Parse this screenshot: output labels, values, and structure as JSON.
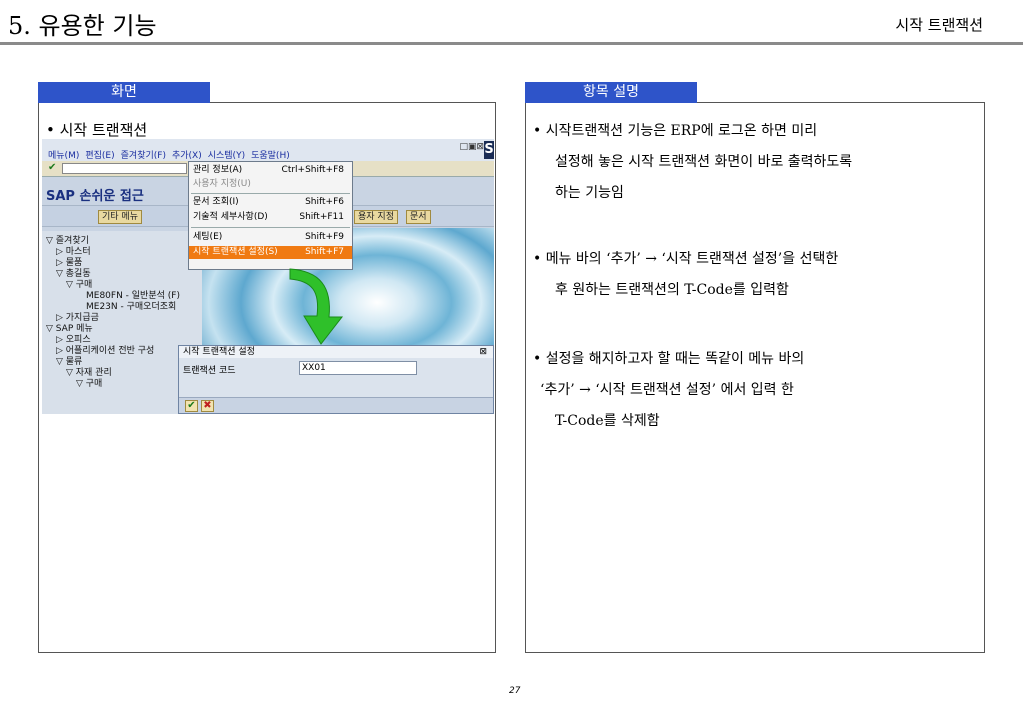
{
  "header": {
    "title": "5. 유용한 기능",
    "subtitle": "시작 트랜잭션"
  },
  "left_panel": {
    "tab": "화면",
    "bullet": "• 시작 트랜잭션"
  },
  "right_panel": {
    "tab": "항목 설명",
    "lines": [
      "• 시작트랜잭션 기능은 ERP에 로그온 하면 미리",
      "설정해 놓은 시작 트랜잭션 화면이 바로 출력하도록",
      "하는 기능임",
      "• 메뉴 바의 ‘추가’ → ‘시작 트랜잭션 설정’을 선택한",
      "후 원하는 트랜잭션의 T-Code를 입력함",
      "• 설정을 해지하고자 할 때는 똑같이 메뉴 바의",
      "‘추가’ → ‘시작 트랜잭션 설정’ 에서 입력 한",
      "T-Code를 삭제함"
    ]
  },
  "sap": {
    "menu": [
      "메뉴(M)",
      "편집(E)",
      "즐겨찾기(F)",
      "추가(X)",
      "시스템(Y)",
      "도움말(H)"
    ],
    "logo_letter": "S",
    "heading": "SAP 손쉬운 접근",
    "buttons": {
      "other_menu": "기타 메뉴",
      "user_setting": "용자 지정",
      "docs": "문서"
    },
    "dropdown": {
      "items": [
        {
          "label": "관리 정보(A)",
          "shortcut": "Ctrl+Shift+F8"
        },
        {
          "label": "사용자 지정(U)",
          "shortcut": ""
        },
        {
          "label": "문서 조회(I)",
          "shortcut": "Shift+F6"
        },
        {
          "label": "기술적 세부사항(D)",
          "shortcut": "Shift+F11"
        },
        {
          "label": "세팅(E)",
          "shortcut": "Shift+F9"
        },
        {
          "label": "시작 트랜잭션 설정(S)",
          "shortcut": "Shift+F7"
        }
      ]
    },
    "tree": [
      "▽ 즐겨찾기",
      "▷ 마스터",
      "▷ 물품",
      "▽ 총길동",
      "▽ 구매",
      "ME80FN - 일반분석 (F)",
      "ME23N - 구매오더조회",
      "▷ 가지급금",
      "▽ SAP 메뉴",
      "▷ 오피스",
      "▷ 어플리케이션 전반 구성",
      "▽ 물류",
      "▽ 자재 관리",
      "▽ 구매"
    ],
    "dialog": {
      "title": "시작 트랜잭션 설정",
      "label": "트랜잭션 코드",
      "value": "XX01",
      "ok": "✔",
      "cancel": "✖"
    }
  },
  "colors": {
    "tab_blue": "#2e54c9",
    "highlight": "#f07a12",
    "arrow": "#2fc02a"
  },
  "footer": {
    "page_number": "27"
  }
}
